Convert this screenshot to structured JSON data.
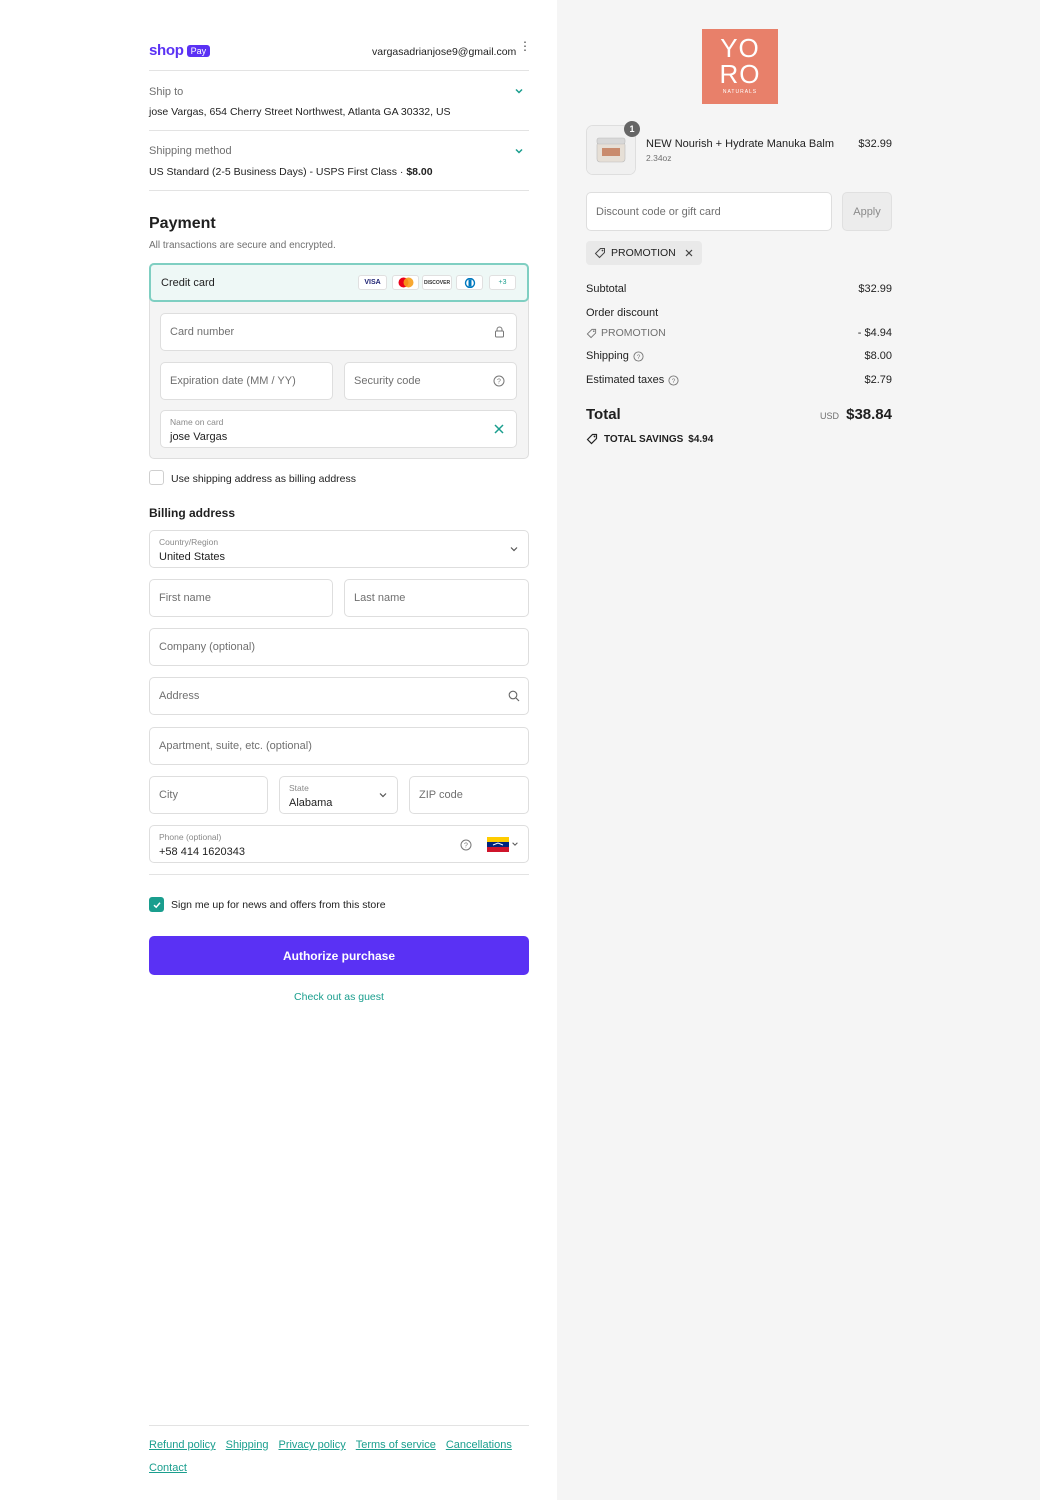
{
  "header": {
    "shop_logo": "shop",
    "pay_badge": "Pay",
    "email": "vargasadrianjose9@gmail.com",
    "menu_icon": "vertical-dots-icon"
  },
  "ship_to": {
    "label": "Ship to",
    "value": "jose Vargas, 654 Cherry Street Northwest, Atlanta GA 30332, US"
  },
  "shipping_method": {
    "label": "Shipping method",
    "value": "US Standard (2-5 Business Days) - USPS First Class · ",
    "price": "$8.00"
  },
  "payment": {
    "title": "Payment",
    "subtitle": "All transactions are secure and encrypted.",
    "method_label": "Credit card",
    "card_logos": [
      "VISA",
      "",
      "DISCOVER",
      "",
      "+3"
    ],
    "card_number_placeholder": "Card number",
    "expiration_placeholder": "Expiration date (MM / YY)",
    "security_placeholder": "Security code",
    "name_label": "Name on card",
    "name_value": "jose Vargas",
    "use_shipping_label": "Use shipping address as billing address"
  },
  "billing": {
    "title": "Billing address",
    "country_label": "Country/Region",
    "country_value": "United States",
    "first_name": "First name",
    "last_name": "Last name",
    "company": "Company (optional)",
    "address": "Address",
    "apartment": "Apartment, suite, etc. (optional)",
    "city": "City",
    "state_label": "State",
    "state_value": "Alabama",
    "zip": "ZIP code",
    "phone_label": "Phone (optional)",
    "phone_value": "+58 414 1620343"
  },
  "newsletter_label": "Sign me up for news and offers from this store",
  "authorize_button": "Authorize purchase",
  "guest_link": "Check out as guest",
  "footer_links": [
    "Refund policy",
    "Shipping",
    "Privacy policy",
    "Terms of service",
    "Cancellations",
    "Contact"
  ],
  "store_logo": {
    "line1": "YO",
    "line2": "RO",
    "line3": "NATURALS",
    "color": "#e8806a"
  },
  "product": {
    "name": "NEW Nourish + Hydrate Manuka Balm",
    "variant": "2.34oz",
    "price": "$32.99",
    "quantity": "1"
  },
  "discount": {
    "placeholder": "Discount code or gift card",
    "apply": "Apply",
    "tag": "PROMOTION"
  },
  "summary": {
    "subtotal_label": "Subtotal",
    "subtotal_value": "$32.99",
    "order_discount_label": "Order discount",
    "promotion_label": "PROMOTION",
    "discount_value": "- $4.94",
    "shipping_label": "Shipping",
    "shipping_value": "$8.00",
    "taxes_label": "Estimated taxes",
    "taxes_value": "$2.79",
    "total_label": "Total",
    "currency": "USD",
    "total_value": "$38.84",
    "savings_label": "TOTAL SAVINGS",
    "savings_value": "$4.94"
  },
  "colors": {
    "accent": "#1a9e8e",
    "shop_purple": "#5a31f4",
    "button": "#5a31f4"
  }
}
